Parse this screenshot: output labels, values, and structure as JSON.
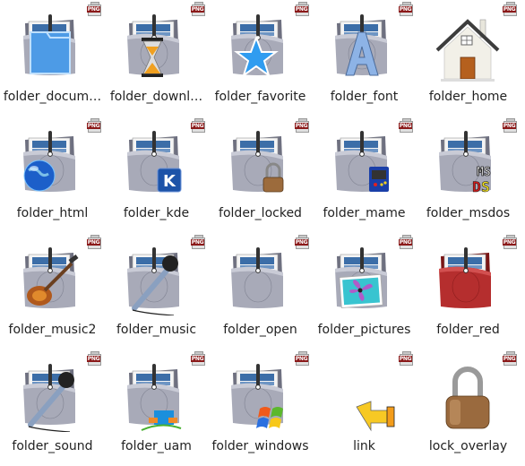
{
  "badge_text": "PNG",
  "items": [
    {
      "label": "folder_docum…",
      "overlay": "document-folder"
    },
    {
      "label": "folder_downl…",
      "overlay": "hourglass"
    },
    {
      "label": "folder_favorite",
      "overlay": "star"
    },
    {
      "label": "folder_font",
      "overlay": "letter-a"
    },
    {
      "label": "folder_home",
      "overlay": "house"
    },
    {
      "label": "folder_html",
      "overlay": "globe"
    },
    {
      "label": "folder_kde",
      "overlay": "kde-logo"
    },
    {
      "label": "folder_locked",
      "overlay": "padlock"
    },
    {
      "label": "folder_mame",
      "overlay": "arcade-cabinet"
    },
    {
      "label": "folder_msdos",
      "overlay": "msdos-logo"
    },
    {
      "label": "folder_music2",
      "overlay": "guitar"
    },
    {
      "label": "folder_music",
      "overlay": "microphone"
    },
    {
      "label": "folder_open",
      "overlay": "none"
    },
    {
      "label": "folder_pictures",
      "overlay": "photo"
    },
    {
      "label": "folder_red",
      "overlay": "red-folder"
    },
    {
      "label": "folder_sound",
      "overlay": "microphone"
    },
    {
      "label": "folder_uam",
      "overlay": "uam-logo"
    },
    {
      "label": "folder_windows",
      "overlay": "windows-logo"
    },
    {
      "label": "link",
      "overlay": "link-arrow"
    },
    {
      "label": "lock_overlay",
      "overlay": "padlock-large"
    }
  ],
  "colors": {
    "folder_gray": "#a9abb8",
    "folder_red": "#b02a2a",
    "badge_red": "#8b1a1a",
    "paper_blue": "#3c6ea8"
  }
}
